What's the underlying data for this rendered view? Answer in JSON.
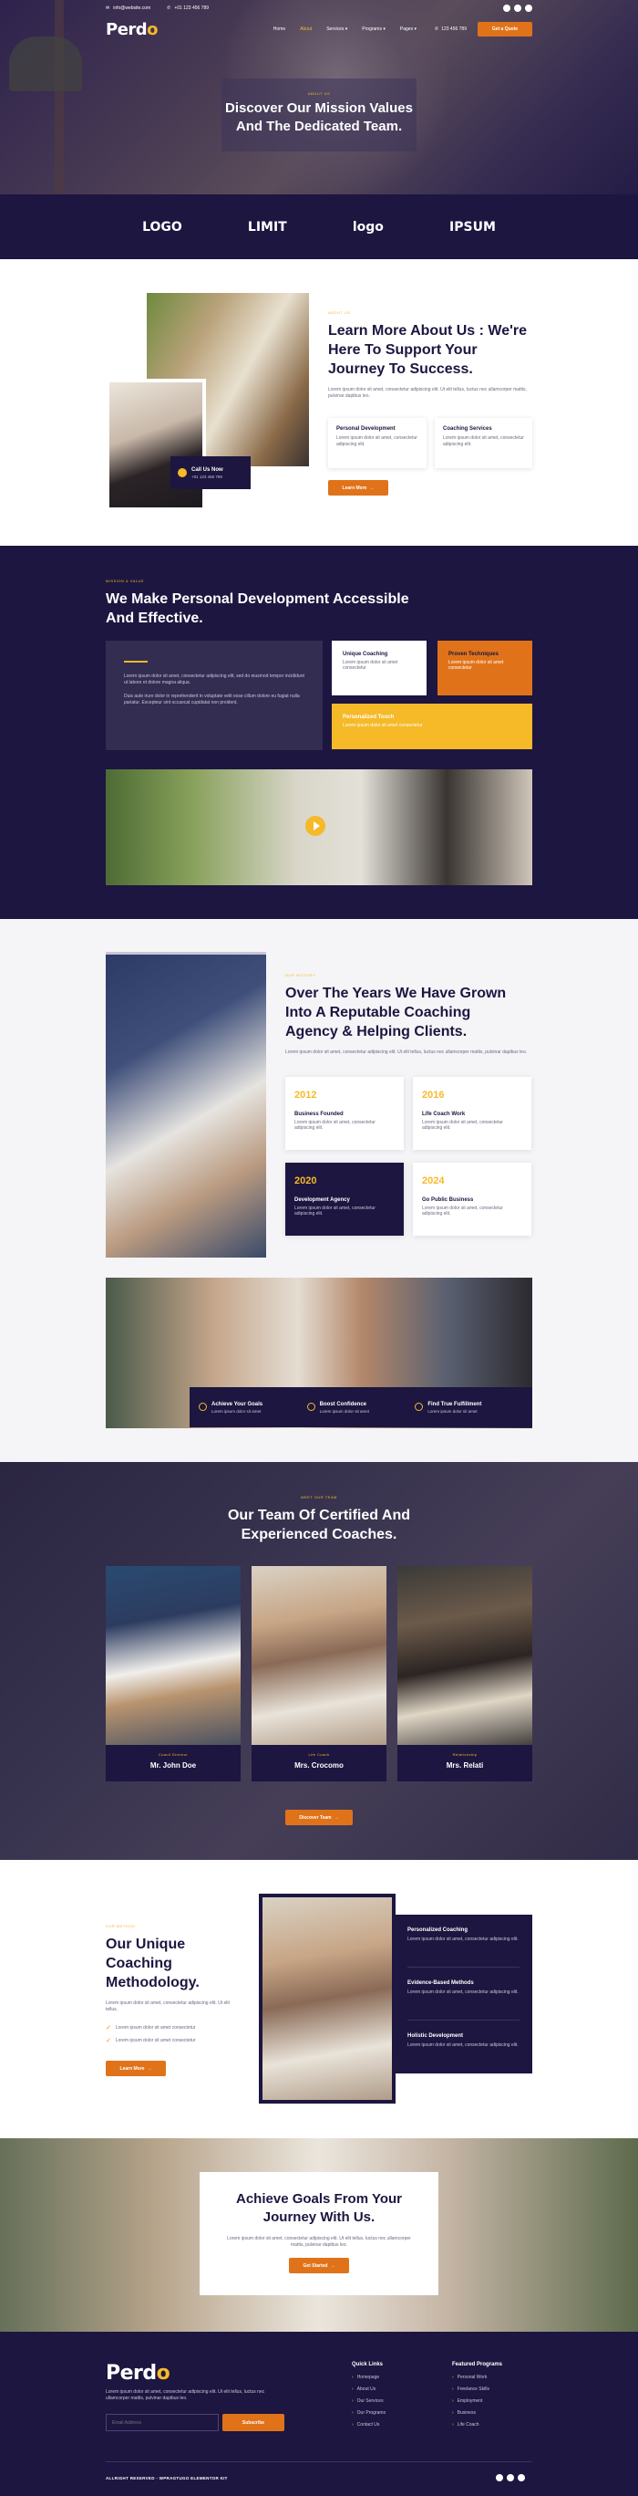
{
  "topbar": {
    "email": "info@website.com",
    "phone": "+01 123 456 789"
  },
  "nav": {
    "logo_a": "Perd",
    "logo_b": "o",
    "items": [
      "Home",
      "About",
      "Services",
      "Programs",
      "Pages"
    ],
    "active_item": "About",
    "phone": "123 456 789",
    "cta": "Get a Quote"
  },
  "hero": {
    "eyebrow": "About Us",
    "title_line1": "Discover Our Mission Values",
    "title_line2": "And The Dedicated Team."
  },
  "logos": [
    "LOGO",
    "LIMIT",
    "logo",
    "IPSUM"
  ],
  "about": {
    "eyebrow": "About Us",
    "title_line1": "Learn More About Us : We're",
    "title_line2": "Here To Support Your",
    "title_line3": "Journey To Success.",
    "body": "Lorem ipsum dolor sit amet, consectetur adipiscing elit. Ut elit tellus, luctus nec ullamcorper mattis, pulvinar dapibus leo.",
    "call_title": "Call Us Now",
    "call_number": "+01 123 456 789",
    "cards": [
      {
        "title": "Personal Development",
        "text": "Lorem ipsum dolor sit amet, consectetur adipiscing elit."
      },
      {
        "title": "Coaching Services",
        "text": "Lorem ipsum dolor sit amet, consectetur adipiscing elit."
      }
    ],
    "button": "Learn More"
  },
  "mission": {
    "eyebrow": "Mission & Value",
    "title_line1": "We Make Personal Development Accessible",
    "title_line2": "And Effective.",
    "para1": "Lorem ipsum dolor sit amet, consectetur adipiscing elit, sed do eiusmod tempor incididunt ut labore et dolore magna aliqua.",
    "para2": "Duis aute irure dolor in reprehenderit in voluptate velit esse cillum dolore eu fugiat nulla pariatur. Excepteur sint occaecat cupidatat non proident.",
    "box1_title": "Unique Coaching",
    "box1_text": "Lorem ipsum dolor sit amet consectetur",
    "box2_title": "Proven Techniques",
    "box2_text": "Lorem ipsum dolor sit amet consectetur",
    "box3_title": "Personalized Touch",
    "box3_text": "Lorem ipsum dolor sit amet consectetur"
  },
  "history": {
    "eyebrow": "Our History",
    "title_line1": "Over The Years We Have Grown",
    "title_line2": "Into A Reputable Coaching",
    "title_line3": "Agency & Helping Clients.",
    "body": "Lorem ipsum dolor sit amet, consectetur adipiscing elit. Ut elit tellus, luctus nec ullamcorper mattis, pulvinar dapibus leo.",
    "years": [
      {
        "year": "2012",
        "title": "Business Founded",
        "text": "Lorem ipsum dolor sit amet, consectetur adipiscing elit."
      },
      {
        "year": "2016",
        "title": "Life Coach Work",
        "text": "Lorem ipsum dolor sit amet, consectetur adipiscing elit."
      },
      {
        "year": "2020",
        "title": "Development Agency",
        "text": "Lorem ipsum dolor sit amet, consectetur adipiscing elit."
      },
      {
        "year": "2024",
        "title": "Go Public Business",
        "text": "Lorem ipsum dolor sit amet, consectetur adipiscing elit."
      }
    ],
    "features": [
      {
        "title": "Achieve Your Goals",
        "text": "Lorem ipsum dolor sit amet"
      },
      {
        "title": "Boost Confidence",
        "text": "Lorem ipsum dolor sit amet"
      },
      {
        "title": "Find True Fulfillment",
        "text": "Lorem ipsum dolor sit amet"
      }
    ]
  },
  "team": {
    "eyebrow": "Meet Our Team",
    "title_line1": "Our Team Of Certified And",
    "title_line2": "Experienced Coaches.",
    "members": [
      {
        "role": "Coach Director",
        "name": "Mr. John Doe"
      },
      {
        "role": "Life Coach",
        "name": "Mrs. Crocomo"
      },
      {
        "role": "Relationship",
        "name": "Mrs. Relati"
      }
    ],
    "button": "Discover Team"
  },
  "method": {
    "eyebrow": "Our Method",
    "title_line1": "Our Unique",
    "title_line2": "Coaching",
    "title_line3": "Methodology.",
    "body": "Lorem ipsum dolor sit amet, consectetur adipiscing elit. Ut elit tellus.",
    "checks": [
      "Lorem ipsum dolor sit amet consectetur",
      "Lorem ipsum dolor sit amet consectetur"
    ],
    "button": "Learn More",
    "items": [
      {
        "title": "Personalized Coaching",
        "text": "Lorem ipsum dolor sit amet, consectetur adipiscing elit."
      },
      {
        "title": "Evidence-Based Methods",
        "text": "Lorem ipsum dolor sit amet, consectetur adipiscing elit."
      },
      {
        "title": "Holistic Development",
        "text": "Lorem ipsum dolor sit amet, consectetur adipiscing elit."
      }
    ]
  },
  "cta": {
    "title_line1": "Achieve Goals From Your",
    "title_line2": "Journey With Us.",
    "body": "Lorem ipsum dolor sit amet, consectetur adipiscing elit. Ut elit tellus, luctus nec ullamcorper mattis, pulvinar dapibus leo.",
    "button": "Get Started"
  },
  "footer": {
    "logo_a": "Perd",
    "logo_b": "o",
    "about": "Lorem ipsum dolor sit amet, consectetur adipiscing elit. Ut elit tellus, luctus nec ullamcorper mattis, pulvinar dapibus leo.",
    "email_placeholder": "Email Address",
    "subscribe": "Subscribe",
    "quick_title": "Quick Links",
    "quick_links": [
      "Homepage",
      "About Us",
      "Our Services",
      "Our Programs",
      "Contact Us"
    ],
    "programs_title": "Featured Programs",
    "programs": [
      "Personal Work",
      "Freelance Skills",
      "Employment",
      "Business",
      "Life Coach"
    ],
    "copyright": "ALLRIGHT RESERVED - WPRAGTUGO ELEMENTOR KIT"
  },
  "colors": {
    "navy": "#1c1640",
    "orange": "#e0731a",
    "yellow": "#f6b928",
    "white": "#ffffff"
  }
}
